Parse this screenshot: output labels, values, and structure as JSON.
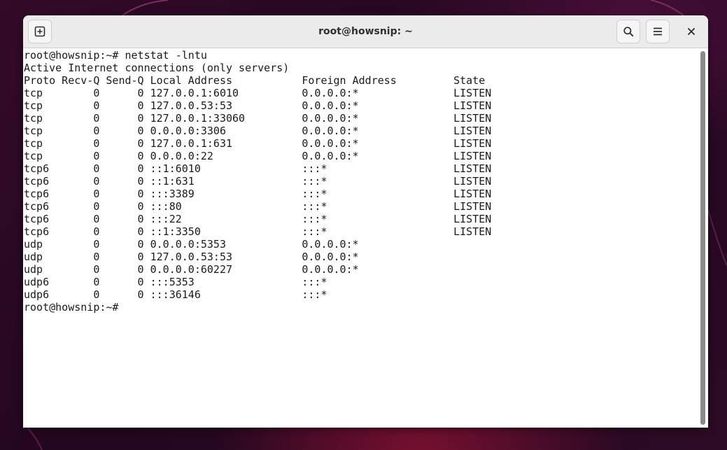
{
  "window": {
    "title": "root@howsnip: ~"
  },
  "headerbar": {
    "new_tab_icon": "new-tab-icon",
    "search_icon": "search-icon",
    "menu_icon": "hamburger-menu-icon",
    "close_icon": "close-icon"
  },
  "terminal": {
    "lines": [
      "root@howsnip:~# netstat -lntu",
      "Active Internet connections (only servers)",
      "Proto Recv-Q Send-Q Local Address           Foreign Address         State",
      "tcp        0      0 127.0.0.1:6010          0.0.0.0:*               LISTEN",
      "tcp        0      0 127.0.0.53:53           0.0.0.0:*               LISTEN",
      "tcp        0      0 127.0.0.1:33060         0.0.0.0:*               LISTEN",
      "tcp        0      0 0.0.0.0:3306            0.0.0.0:*               LISTEN",
      "tcp        0      0 127.0.0.1:631           0.0.0.0:*               LISTEN",
      "tcp        0      0 0.0.0.0:22              0.0.0.0:*               LISTEN",
      "tcp6       0      0 ::1:6010                :::*                    LISTEN",
      "tcp6       0      0 ::1:631                 :::*                    LISTEN",
      "tcp6       0      0 :::3389                 :::*                    LISTEN",
      "tcp6       0      0 :::80                   :::*                    LISTEN",
      "tcp6       0      0 :::22                   :::*                    LISTEN",
      "tcp6       0      0 ::1:3350                :::*                    LISTEN",
      "udp        0      0 0.0.0.0:5353            0.0.0.0:*",
      "udp        0      0 127.0.0.53:53           0.0.0.0:*",
      "udp        0      0 0.0.0.0:60227           0.0.0.0:*",
      "udp6       0      0 :::5353                 :::*",
      "udp6       0      0 :::36146                :::*",
      "root@howsnip:~# "
    ]
  },
  "colors": {
    "desktop_background": "#2a0a22",
    "headerbar": "#ebebeb",
    "terminal_background": "#ffffff",
    "terminal_text": "#1a1a1a"
  }
}
